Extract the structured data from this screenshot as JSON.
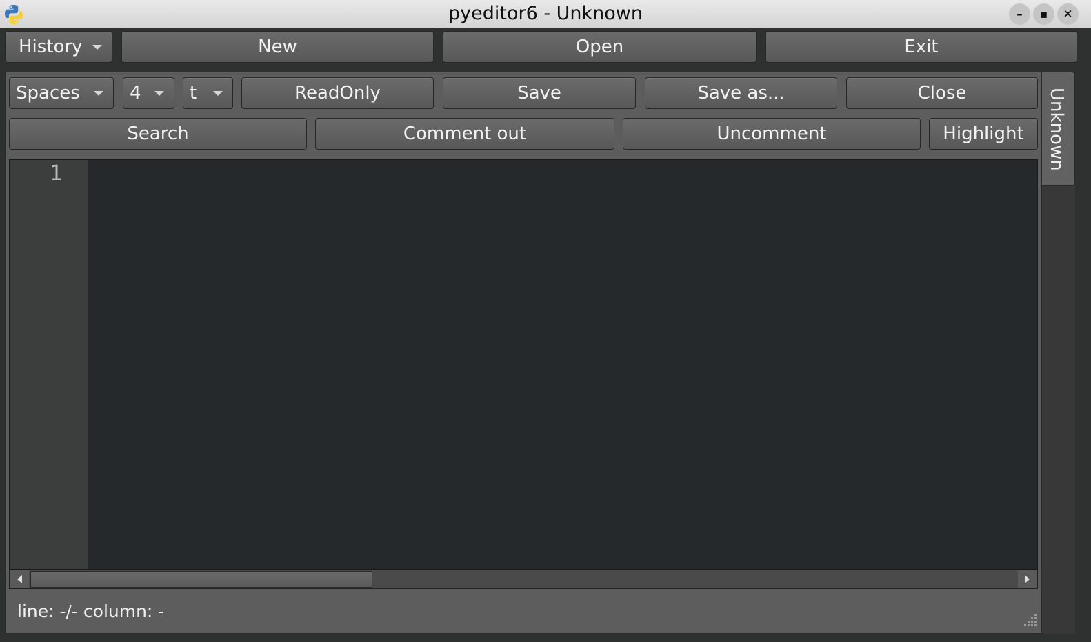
{
  "window": {
    "title": "pyeditor6 - Unknown",
    "minimize_glyph": "–",
    "maximize_glyph": "▪",
    "close_glyph": "✕"
  },
  "toolbar": {
    "history_label": "History",
    "new_label": "New",
    "open_label": "Open",
    "exit_label": "Exit"
  },
  "tab": {
    "label": "Unknown"
  },
  "edit_toolbar": {
    "indent_mode": "Spaces",
    "indent_width": "4",
    "third_combo": "t",
    "readonly_label": "ReadOnly",
    "save_label": "Save",
    "save_as_label": "Save as...",
    "close_label": "Close",
    "search_label": "Search",
    "comment_label": "Comment out",
    "uncomment_label": "Uncomment",
    "highlight_label": "Highlight"
  },
  "editor": {
    "line_numbers": [
      "1"
    ]
  },
  "status": {
    "text": "line: -/- column: -"
  }
}
